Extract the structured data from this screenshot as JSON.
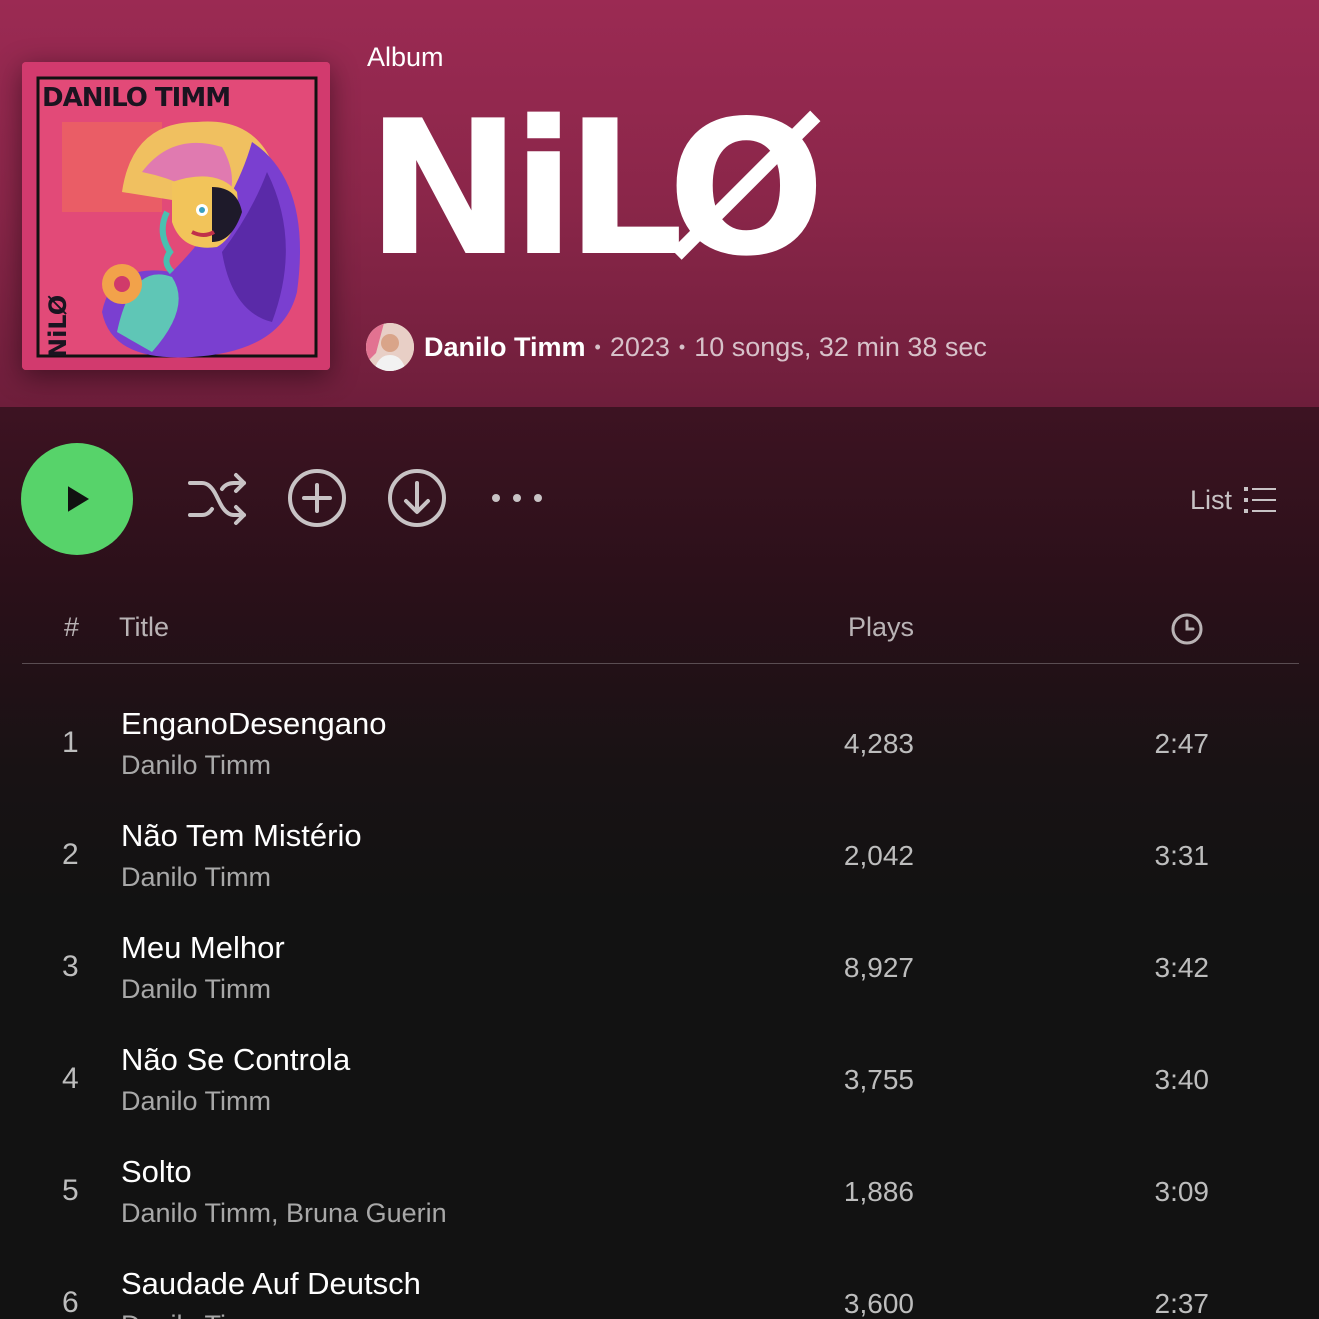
{
  "header": {
    "type_label": "Album",
    "title": "NiLØ",
    "artist": "Danilo Timm",
    "year": "2023",
    "summary": "10 songs, 32 min 38 sec",
    "cover_text_top": "DANILO TIMM",
    "cover_text_side": "NiLØ"
  },
  "controls": {
    "play": "play-icon",
    "shuffle": "shuffle-icon",
    "add": "add-circle-icon",
    "download": "download-icon",
    "more": "more-icon",
    "view_label": "List"
  },
  "table": {
    "col_number": "#",
    "col_title": "Title",
    "col_plays": "Plays",
    "col_duration_icon": "clock-icon",
    "tracks": [
      {
        "number": "1",
        "title": "EnganoDesengano",
        "artists": "Danilo Timm",
        "plays": "4,283",
        "duration": "2:47"
      },
      {
        "number": "2",
        "title": "Não Tem Mistério",
        "artists": "Danilo Timm",
        "plays": "2,042",
        "duration": "3:31"
      },
      {
        "number": "3",
        "title": "Meu Melhor",
        "artists": "Danilo Timm",
        "plays": "8,927",
        "duration": "3:42"
      },
      {
        "number": "4",
        "title": "Não Se Controla",
        "artists": "Danilo Timm",
        "plays": "3,755",
        "duration": "3:40"
      },
      {
        "number": "5",
        "title": "Solto",
        "artists": "Danilo Timm, Bruna Guerin",
        "plays": "1,886",
        "duration": "3:09"
      },
      {
        "number": "6",
        "title": "Saudade Auf Deutsch",
        "artists": "Danilo Timm",
        "plays": "3,600",
        "duration": "2:37"
      }
    ]
  },
  "colors": {
    "accent_green": "#57d36a",
    "hero_top": "#9b2a53",
    "background": "#121212"
  }
}
